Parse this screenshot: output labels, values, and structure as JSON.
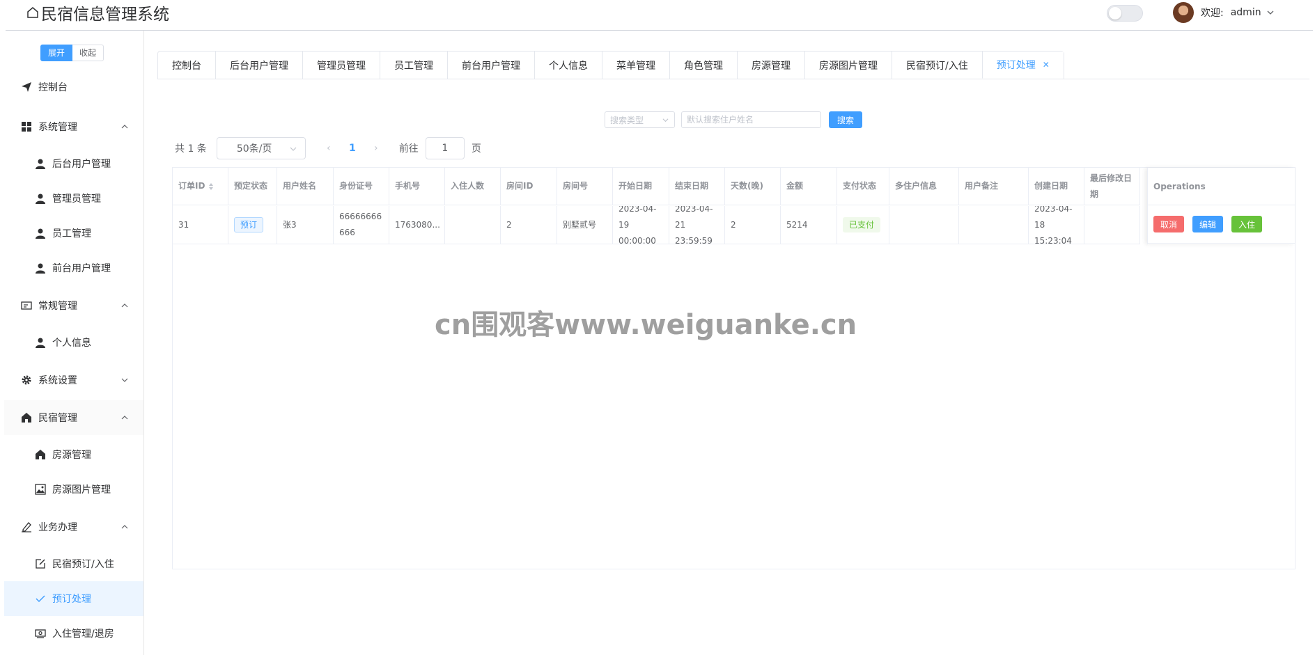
{
  "header": {
    "title": "民宿信息管理系统",
    "welcome": "欢迎:",
    "username": "admin"
  },
  "sidebar": {
    "expand_label": "展开",
    "collapse_label": "收起",
    "items": [
      {
        "label": "控制台",
        "icon": "send-icon"
      },
      {
        "label": "系统管理",
        "icon": "grid-icon"
      },
      {
        "label": "后台用户管理",
        "icon": "user-icon"
      },
      {
        "label": "管理员管理",
        "icon": "user-icon"
      },
      {
        "label": "员工管理",
        "icon": "user-icon"
      },
      {
        "label": "前台用户管理",
        "icon": "user-icon"
      },
      {
        "label": "常规管理",
        "icon": "postcard-icon"
      },
      {
        "label": "个人信息",
        "icon": "user-icon"
      },
      {
        "label": "系统设置",
        "icon": "gear-icon"
      },
      {
        "label": "民宿管理",
        "icon": "home-icon"
      },
      {
        "label": "房源管理",
        "icon": "home-icon"
      },
      {
        "label": "房源图片管理",
        "icon": "picture-icon"
      },
      {
        "label": "业务办理",
        "icon": "edit-pen-icon"
      },
      {
        "label": "民宿预订/入住",
        "icon": "edit-box-icon"
      },
      {
        "label": "预订处理",
        "icon": "check-icon"
      },
      {
        "label": "入住管理/退房",
        "icon": "money-icon"
      }
    ]
  },
  "tabs": [
    "控制台",
    "后台用户管理",
    "管理员管理",
    "员工管理",
    "前台用户管理",
    "个人信息",
    "菜单管理",
    "角色管理",
    "房源管理",
    "房源图片管理",
    "民宿预订/入住",
    "预订处理"
  ],
  "search": {
    "type_placeholder": "搜索类型",
    "input_placeholder": "默认搜索住户姓名",
    "button_label": "搜索"
  },
  "pagination": {
    "total": "共 1 条",
    "page_size": "50条/页",
    "current_page": "1",
    "goto_label": "前往",
    "goto_value": "1",
    "page_unit": "页"
  },
  "table": {
    "columns": [
      "订单ID",
      "预定状态",
      "用户姓名",
      "身份证号",
      "手机号",
      "入住人数",
      "房间ID",
      "房间号",
      "开始日期",
      "结束日期",
      "天数(晚)",
      "金额",
      "支付状态",
      "多住户信息",
      "用户备注",
      "创建日期",
      "最后修改日期"
    ],
    "operations_label": "Operations",
    "rows": [
      {
        "order_id": "31",
        "status": "预订",
        "user_name": "张3",
        "id_card": "66666666666",
        "phone": "1763080...",
        "guests": "",
        "room_id": "2",
        "room_no": "别墅贰号",
        "start_date": "2023-04-19 00:00:00",
        "end_date": "2023-04-21 23:59:59",
        "nights": "2",
        "amount": "5214",
        "pay_status": "已支付",
        "multi_guests": "",
        "remark": "",
        "created": "2023-04-18 15:23:04",
        "modified": ""
      }
    ],
    "actions": {
      "cancel": "取消",
      "edit": "编辑",
      "checkin": "入住"
    }
  },
  "watermark": "cn围观客www.weiguanke.cn",
  "colors": {
    "primary": "#409eff",
    "danger": "#f56c6c",
    "success": "#67c23a"
  }
}
